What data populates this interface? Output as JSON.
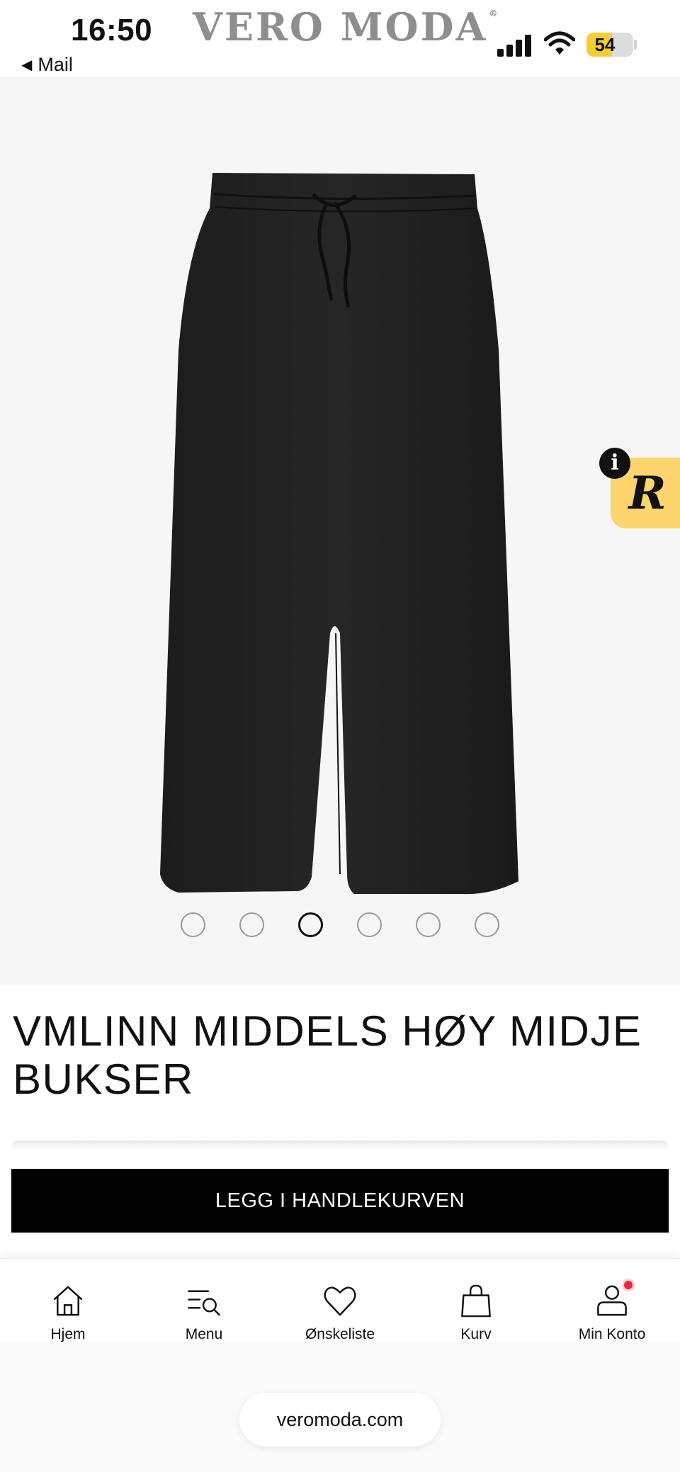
{
  "status_bar": {
    "time": "16:50",
    "back_label": "Mail",
    "battery_percent": "54",
    "battery_level": 0.54
  },
  "brand": {
    "name": "VERO MODA",
    "registered_mark": "®"
  },
  "product": {
    "title": "VMLINN MIDDELS HØY MIDJE BUKSER",
    "image_count": 6,
    "active_image_index": 2
  },
  "review_badge": {
    "letter": "R",
    "info_glyph": "i",
    "color": "#fcd56f"
  },
  "cart_button": {
    "label": "LEGG I HANDLEKURVEN"
  },
  "bottom_nav": {
    "items": [
      {
        "label": "Hjem",
        "icon": "home-icon"
      },
      {
        "label": "Menu",
        "icon": "menu-search-icon"
      },
      {
        "label": "Ønskeliste",
        "icon": "heart-icon"
      },
      {
        "label": "Kurv",
        "icon": "bag-icon"
      },
      {
        "label": "Min Konto",
        "icon": "account-icon"
      }
    ]
  },
  "browser": {
    "url": "veromoda.com"
  },
  "colors": {
    "accent_button": "#000000",
    "notification": "#e8283a"
  }
}
